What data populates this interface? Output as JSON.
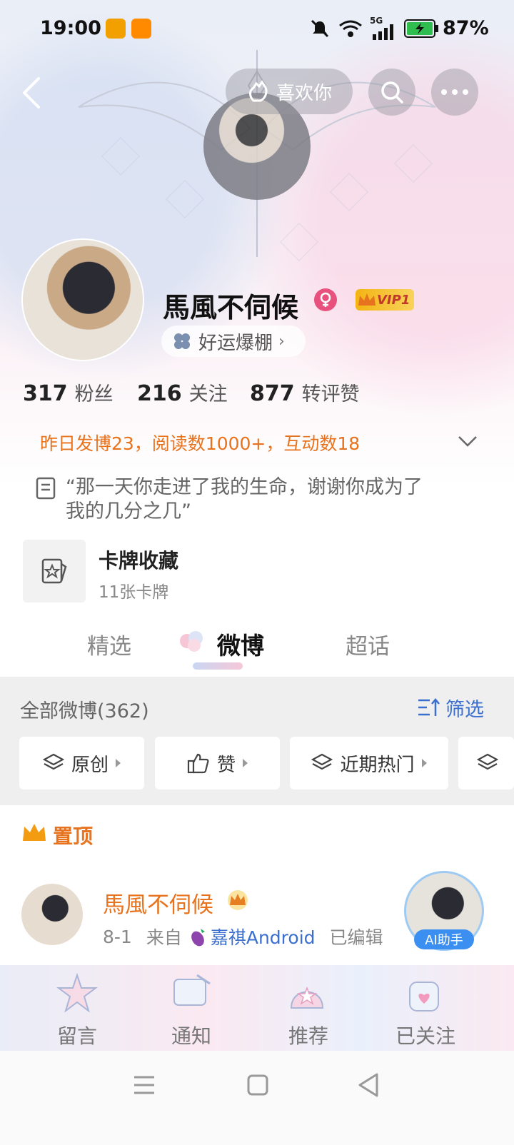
{
  "status_bar": {
    "time": "19:00",
    "network": "5G",
    "battery": "87%"
  },
  "top_actions": {
    "like_label": "喜欢你"
  },
  "profile": {
    "name": "馬風不伺候",
    "vip_label": "VIP1",
    "badge_label": "好运爆棚",
    "stats": [
      {
        "num": "317",
        "label": "粉丝"
      },
      {
        "num": "216",
        "label": "关注"
      },
      {
        "num": "877",
        "label": "转评赞"
      }
    ],
    "activity": "昨日发博23，阅读数1000+，互动数18",
    "bio_line1": "“那一天你走进了我的生命，谢谢你成为了",
    "bio_line2": "我的几分之几”"
  },
  "card_collection": {
    "title": "卡牌收藏",
    "subtitle": "11张卡牌"
  },
  "tabs": [
    {
      "label": "精选"
    },
    {
      "label": "微博"
    },
    {
      "label": "超话"
    }
  ],
  "feed_header": {
    "count_label": "全部微博(362)",
    "filter_label": "筛选"
  },
  "filters": [
    {
      "label": "原创"
    },
    {
      "label": "赞"
    },
    {
      "label": "近期热门"
    }
  ],
  "pinned": {
    "label": "置顶"
  },
  "post": {
    "author": "馬風不伺候",
    "date": "8-1",
    "from_label": "来自",
    "source": "嘉祺Android",
    "edited": "已编辑",
    "ai_label": "AI助手"
  },
  "bottom_tabs": [
    {
      "label": "留言"
    },
    {
      "label": "通知"
    },
    {
      "label": "推荐"
    },
    {
      "label": "已关注"
    }
  ],
  "colors": {
    "accent_orange": "#e8731f",
    "vip_gold": "#f3b414",
    "female_pink": "#e8507d"
  }
}
